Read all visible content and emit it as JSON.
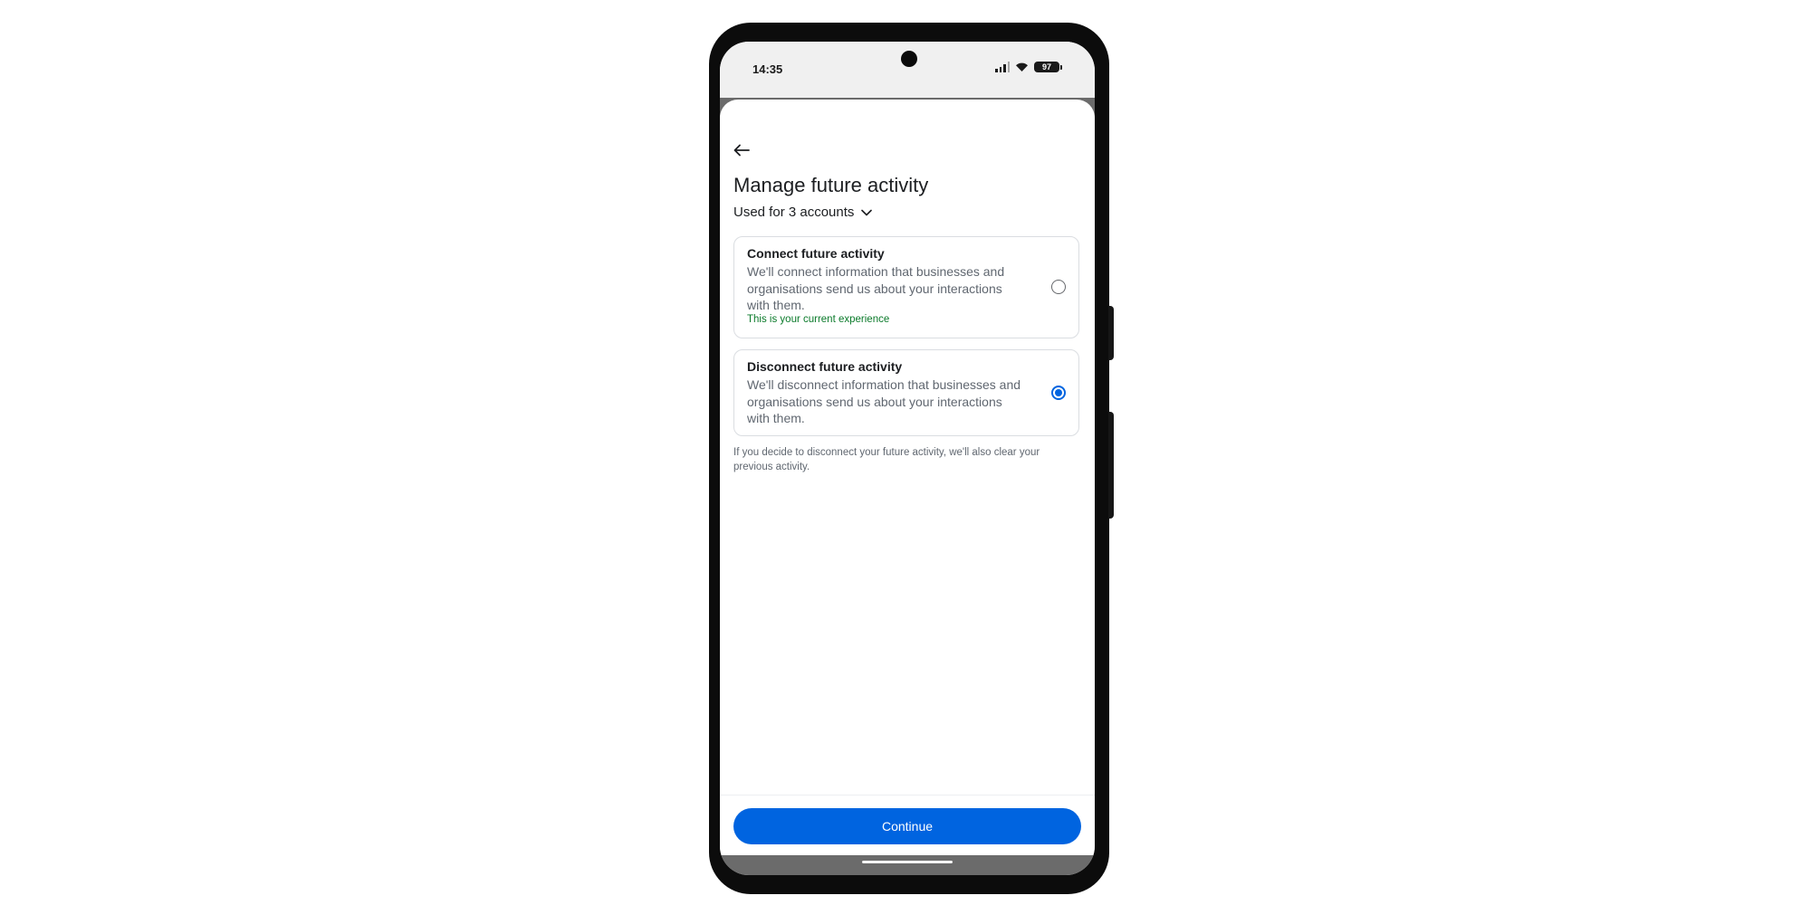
{
  "status_bar": {
    "time": "14:35",
    "battery": "97"
  },
  "header": {
    "back_icon": "arrow-left-icon",
    "title": "Manage future activity",
    "accounts_label": "Used for 3 accounts",
    "accounts_icon": "chevron-down-icon"
  },
  "options": [
    {
      "title": "Connect future activity",
      "description": "We'll connect information that businesses and organisations send us about your interactions with them.",
      "note": "This is your current experience",
      "selected": false
    },
    {
      "title": "Disconnect future activity",
      "description": "We'll disconnect information that businesses and organisations send us about your interactions with them.",
      "selected": true
    }
  ],
  "footnote": "If you decide to disconnect your future activity, we'll also clear your previous activity.",
  "footer": {
    "continue_label": "Continue"
  },
  "colors": {
    "accent": "#0064e0",
    "note_green": "#0a7a2a",
    "backdrop": "#6b6b6b"
  }
}
